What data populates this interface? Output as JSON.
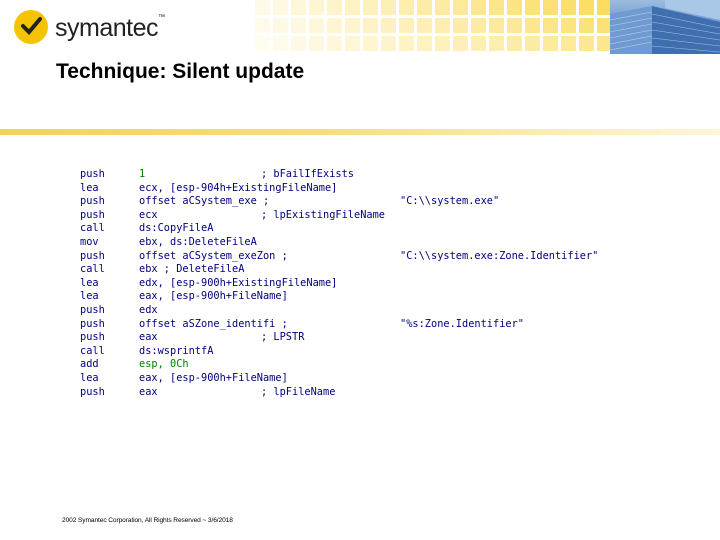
{
  "header": {
    "brand": "symantec",
    "brand_tm": "™",
    "logo_color": "#f5c400"
  },
  "slide": {
    "title": "Technique: Silent update"
  },
  "code_lines": [
    {
      "op": "push",
      "arg": "1",
      "comment": "; bFailIfExists"
    },
    {
      "op": "lea",
      "arg": "ecx, [esp-904h+ExistingFileName]",
      "comment": ""
    },
    {
      "op": "push",
      "arg": "offset aCSystem_exe ;",
      "comment": "\"C:\\\\system.exe\""
    },
    {
      "op": "push",
      "arg": "ecx",
      "comment": "; lpExistingFileName"
    },
    {
      "op": "call",
      "arg": "ds:CopyFileA",
      "comment": ""
    },
    {
      "op": "mov",
      "arg": "ebx, ds:DeleteFileA",
      "comment": ""
    },
    {
      "op": "push",
      "arg": "offset aCSystem_exeZon ;",
      "comment": "\"C:\\\\system.exe:Zone.Identifier\""
    },
    {
      "op": "call",
      "arg": "ebx ; DeleteFileA",
      "comment": ""
    },
    {
      "op": "lea",
      "arg": "edx, [esp-900h+ExistingFileName]",
      "comment": ""
    },
    {
      "op": "lea",
      "arg": "eax, [esp-900h+FileName]",
      "comment": ""
    },
    {
      "op": "push",
      "arg": "edx",
      "comment": ""
    },
    {
      "op": "push",
      "arg": "offset aSZone_identifi ;",
      "comment": "\"%s:Zone.Identifier\""
    },
    {
      "op": "push",
      "arg": "eax",
      "comment": "; LPSTR"
    },
    {
      "op": "call",
      "arg": "ds:wsprintfA",
      "comment": ""
    },
    {
      "op": "add",
      "arg": "esp, 0Ch",
      "comment": ""
    },
    {
      "op": "lea",
      "arg": "eax, [esp-900h+FileName]",
      "comment": ""
    },
    {
      "op": "push",
      "arg": "eax",
      "comment": "; lpFileName"
    }
  ],
  "footer": {
    "text": "2002 Symantec Corporation, All Rights Reserved ~ 3/6/2018"
  }
}
